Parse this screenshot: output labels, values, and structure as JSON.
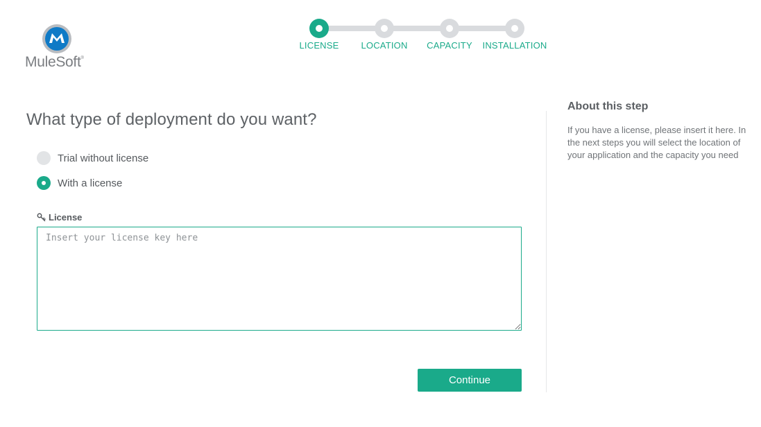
{
  "brand": {
    "name": "MuleSoft",
    "trademark": "®",
    "mark_color": "#0f7ac6"
  },
  "stepper": {
    "steps": [
      {
        "label": "LICENSE",
        "active": true
      },
      {
        "label": "LOCATION",
        "active": false
      },
      {
        "label": "CAPACITY",
        "active": false
      },
      {
        "label": "INSTALLATION",
        "active": false
      }
    ]
  },
  "form": {
    "title": "What type of deployment do you want?",
    "options": [
      {
        "label": "Trial without license",
        "selected": false
      },
      {
        "label": "With a license",
        "selected": true
      }
    ],
    "license_label": "License",
    "license_value": "",
    "license_placeholder": "Insert your license key here",
    "continue_label": "Continue"
  },
  "sidebar": {
    "title": "About this step",
    "text": "If you have a license, please insert it here. In the next steps you will select the location of your application and the capacity you need"
  },
  "colors": {
    "accent": "#1aaa8a",
    "inactive": "#d9dbde"
  }
}
